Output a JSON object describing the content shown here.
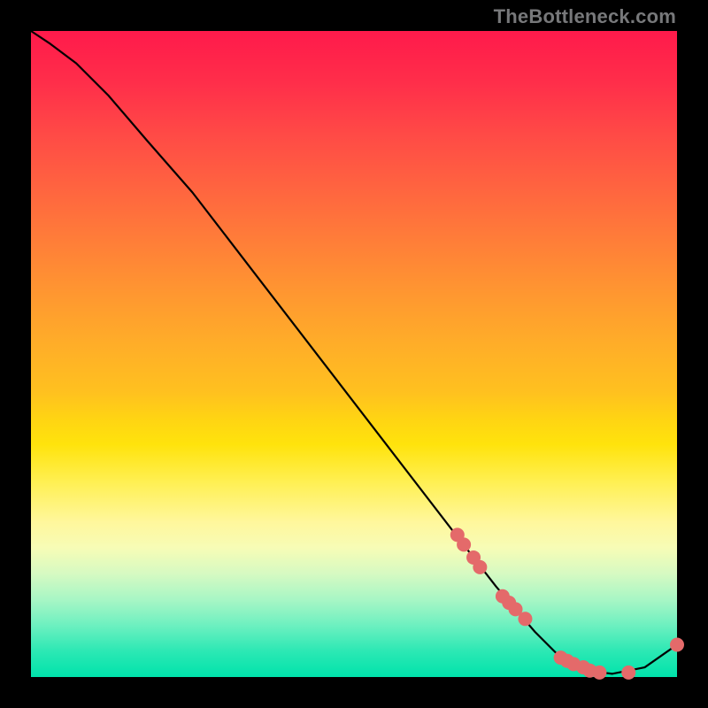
{
  "watermark": "TheBottleneck.com",
  "chart_data": {
    "type": "line",
    "title": "",
    "xlabel": "",
    "ylabel": "",
    "xlim": [
      0,
      100
    ],
    "ylim": [
      0,
      100
    ],
    "grid": false,
    "legend": false,
    "series": [
      {
        "name": "curve",
        "stroke": "#000000",
        "x": [
          0,
          3,
          7,
          12,
          18,
          25,
          35,
          45,
          55,
          65,
          72,
          78,
          82,
          86,
          90,
          95,
          100
        ],
        "y": [
          100,
          98,
          95,
          90,
          83,
          75,
          62,
          49,
          36,
          23,
          14,
          7,
          3,
          1,
          0.5,
          1.5,
          5
        ]
      }
    ],
    "markers": {
      "color": "#e46a6a",
      "radius_px": 8,
      "points": [
        {
          "x": 66,
          "y": 22
        },
        {
          "x": 67,
          "y": 20.5
        },
        {
          "x": 68.5,
          "y": 18.5
        },
        {
          "x": 69.5,
          "y": 17
        },
        {
          "x": 73,
          "y": 12.5
        },
        {
          "x": 74,
          "y": 11.5
        },
        {
          "x": 75,
          "y": 10.5
        },
        {
          "x": 76.5,
          "y": 9
        },
        {
          "x": 82,
          "y": 3
        },
        {
          "x": 83,
          "y": 2.5
        },
        {
          "x": 84,
          "y": 2
        },
        {
          "x": 85.5,
          "y": 1.5
        },
        {
          "x": 86.5,
          "y": 1
        },
        {
          "x": 88,
          "y": 0.7
        },
        {
          "x": 92.5,
          "y": 0.7
        },
        {
          "x": 100,
          "y": 5
        }
      ]
    }
  },
  "colors": {
    "background": "#000000",
    "curve": "#000000",
    "marker": "#e46a6a",
    "watermark": "#77787a"
  }
}
